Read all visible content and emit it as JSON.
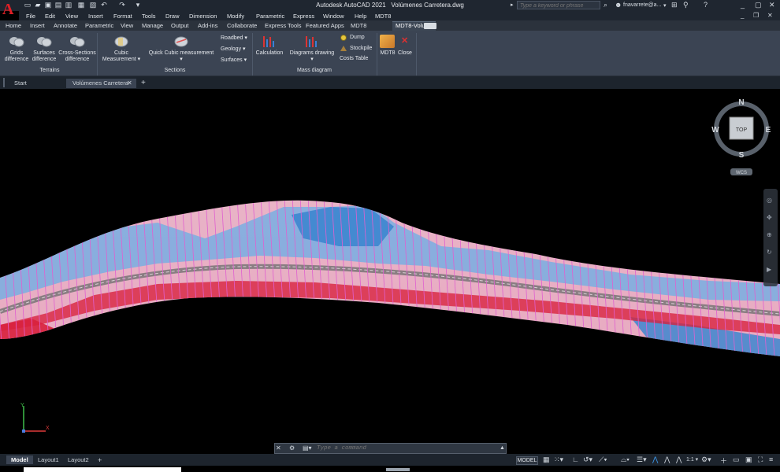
{
  "app": {
    "title": "Autodesk AutoCAD 2021",
    "file": "Volúmenes Carretera.dwg",
    "logo": "A",
    "user": "fnavarrete@a...",
    "search_placeholder": "Type a keyword or phrase"
  },
  "menu": [
    "File",
    "Edit",
    "View",
    "Insert",
    "Format",
    "Tools",
    "Draw",
    "Dimension",
    "Modify",
    "Parametric",
    "Express",
    "Window",
    "Help",
    "MDT8"
  ],
  "ribbon_tabs": [
    "Home",
    "Insert",
    "Annotate",
    "Parametric",
    "View",
    "Manage",
    "Output",
    "Add-ins",
    "Collaborate",
    "Express Tools",
    "Featured Apps",
    "MDT8",
    "MDT8-Volumes"
  ],
  "active_ribbon_tab": "MDT8-Volumes",
  "ribbon": {
    "terrains": {
      "title": "Terrains",
      "grids_difference": [
        "Grids",
        "difference"
      ],
      "surfaces_difference": [
        "Surfaces",
        "difference"
      ],
      "cross_sections_difference": [
        "Cross-Sections",
        "difference"
      ]
    },
    "sections": {
      "title": "Sections",
      "cubic_measurement": [
        "Cubic",
        "Measurement"
      ],
      "quick_cubic": "Quick Cubic measurement",
      "roadbed": "Roadbed",
      "geology": "Geology",
      "surfaces": "Surfaces"
    },
    "mass_diagram": {
      "title": "Mass diagram",
      "calculation": "Calculation",
      "diagrams_drawing": "Diagrams drawing",
      "dump": "Dump",
      "stockpile": "Stockpile",
      "costs_table": "Costs Table"
    },
    "mdt8": "MDT8",
    "close": "Close"
  },
  "doc_tabs": [
    "Start",
    "Volúmenes Carretera"
  ],
  "viewcube": {
    "top": "TOP",
    "n": "N",
    "s": "S",
    "e": "E",
    "w": "W",
    "ucs": "WCS"
  },
  "command": {
    "placeholder": "Type a command"
  },
  "layout_tabs": [
    "Model",
    "Layout1",
    "Layout2"
  ],
  "status": {
    "model": "MODEL",
    "scale": "1:1"
  },
  "colors": {
    "cut": "#d8203c",
    "fill": "#4f9fd8",
    "section_lines": "#e060d0",
    "road": "#8a7d82",
    "accent": "#e01f26"
  }
}
